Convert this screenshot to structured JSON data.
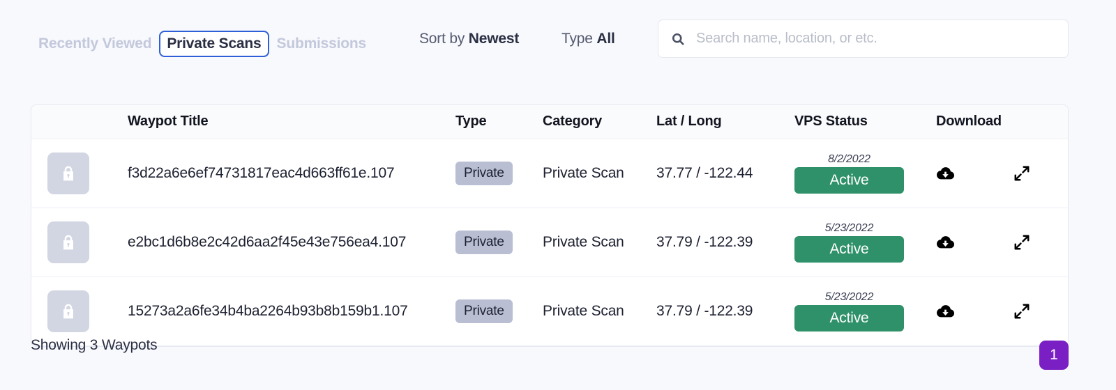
{
  "colors": {
    "page_background": "#f8f9fc",
    "accent_blue": "#2f5fd8",
    "status_green": "#2f9169",
    "badge_gray": "#b9bed3",
    "pager_purple": "#7a1fc4"
  },
  "toolbar": {
    "tabs": [
      {
        "label": "Recently Viewed",
        "active": false
      },
      {
        "label": "Private Scans",
        "active": true
      },
      {
        "label": "Submissions",
        "active": false
      }
    ],
    "sort": {
      "prefix": "Sort by",
      "value": "Newest"
    },
    "type": {
      "prefix": "Type",
      "value": "All"
    },
    "search": {
      "placeholder": "Search name, location, or etc.",
      "value": ""
    },
    "search_icon": "search-icon"
  },
  "table": {
    "columns": [
      {
        "key": "thumbnail",
        "label": ""
      },
      {
        "key": "title",
        "label": "Waypot Title"
      },
      {
        "key": "type",
        "label": "Type"
      },
      {
        "key": "category",
        "label": "Category"
      },
      {
        "key": "latlong",
        "label": "Lat / Long"
      },
      {
        "key": "vps_status",
        "label": "VPS Status"
      },
      {
        "key": "download",
        "label": "Download"
      },
      {
        "key": "expand",
        "label": ""
      }
    ],
    "rows": [
      {
        "thumbnail_icon": "lock-icon",
        "title": "f3d22a6e6ef74731817eac4d663ff61e.107",
        "type": "Private",
        "category": "Private Scan",
        "latlong": "37.77 / -122.44",
        "vps_date": "8/2/2022",
        "vps_status": "Active",
        "download_icon": "cloud-download-icon",
        "expand_icon": "expand-arrows-icon"
      },
      {
        "thumbnail_icon": "lock-icon",
        "title": "e2bc1d6b8e2c42d6aa2f45e43e756ea4.107",
        "type": "Private",
        "category": "Private Scan",
        "latlong": "37.79 / -122.39",
        "vps_date": "5/23/2022",
        "vps_status": "Active",
        "download_icon": "cloud-download-icon",
        "expand_icon": "expand-arrows-icon"
      },
      {
        "thumbnail_icon": "lock-icon",
        "title": "15273a2a6fe34b4ba2264b93b8b159b1.107",
        "type": "Private",
        "category": "Private Scan",
        "latlong": "37.79 / -122.39",
        "vps_date": "5/23/2022",
        "vps_status": "Active",
        "download_icon": "cloud-download-icon",
        "expand_icon": "expand-arrows-icon"
      }
    ]
  },
  "footer": {
    "count_text": "Showing 3 Waypots",
    "pages": [
      {
        "label": "1",
        "active": true
      }
    ]
  }
}
